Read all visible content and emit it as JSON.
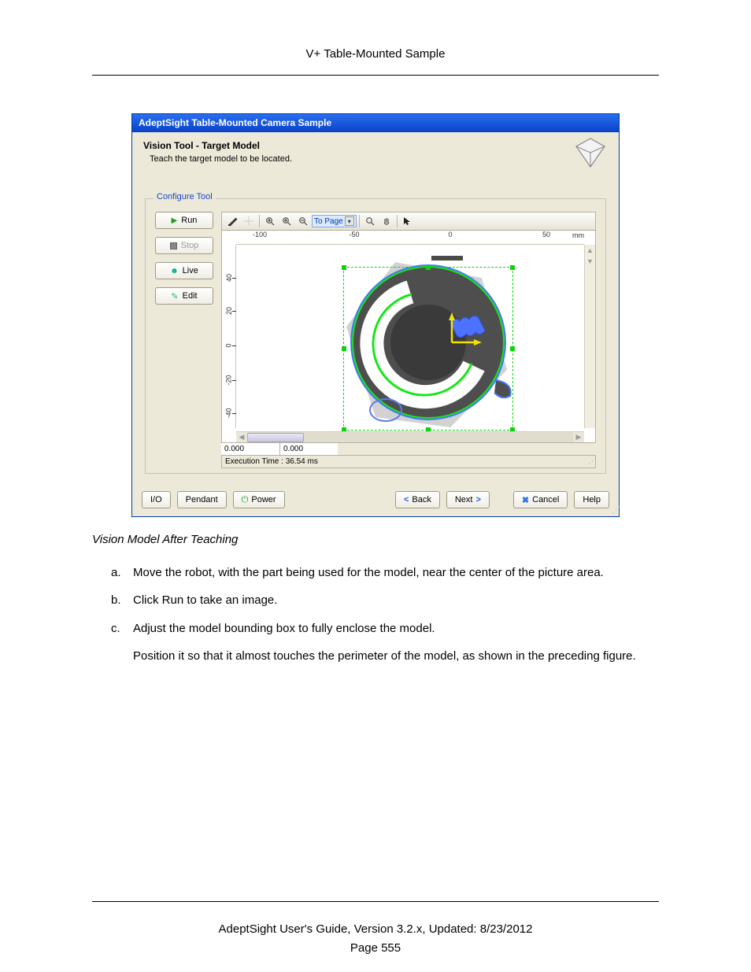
{
  "doc": {
    "header": "V+ Table-Mounted Sample",
    "caption": "Vision Model After Teaching",
    "footer": "AdeptSight User's Guide,  Version 3.2.x, Updated: 8/23/2012",
    "page_number": "Page 555"
  },
  "steps": {
    "a": {
      "marker": "a.",
      "text": "Move the robot, with the part being used for the model, near the center of the picture area."
    },
    "b": {
      "marker": "b.",
      "text": "Click Run to take an image."
    },
    "c": {
      "marker": "c.",
      "text": "Adjust the model bounding box to fully enclose the model.",
      "note": "Position it so that it almost touches the perimeter of the model, as shown in the preceding figure."
    }
  },
  "win": {
    "title": "AdeptSight Table-Mounted Camera Sample",
    "section_title": "Vision Tool - Target Model",
    "section_sub": "Teach the target model to be located.",
    "configure_legend": "Configure Tool",
    "buttons": {
      "run": "Run",
      "stop": "Stop",
      "live": "Live",
      "edit": "Edit"
    },
    "toolbar": {
      "to_page": "To Page"
    },
    "ruler": {
      "unit": "mm",
      "x_ticks": [
        "-100",
        "-50",
        "0",
        "50"
      ],
      "y_ticks": [
        "40",
        "20",
        "0",
        "-20",
        "-40"
      ]
    },
    "status": {
      "x": "0.000",
      "y": "0.000",
      "exec": "Execution Time : 36.54 ms"
    },
    "bottom": {
      "io": "I/O",
      "pendant": "Pendant",
      "power": "Power",
      "back": "Back",
      "next": "Next",
      "cancel": "Cancel",
      "help": "Help"
    }
  }
}
